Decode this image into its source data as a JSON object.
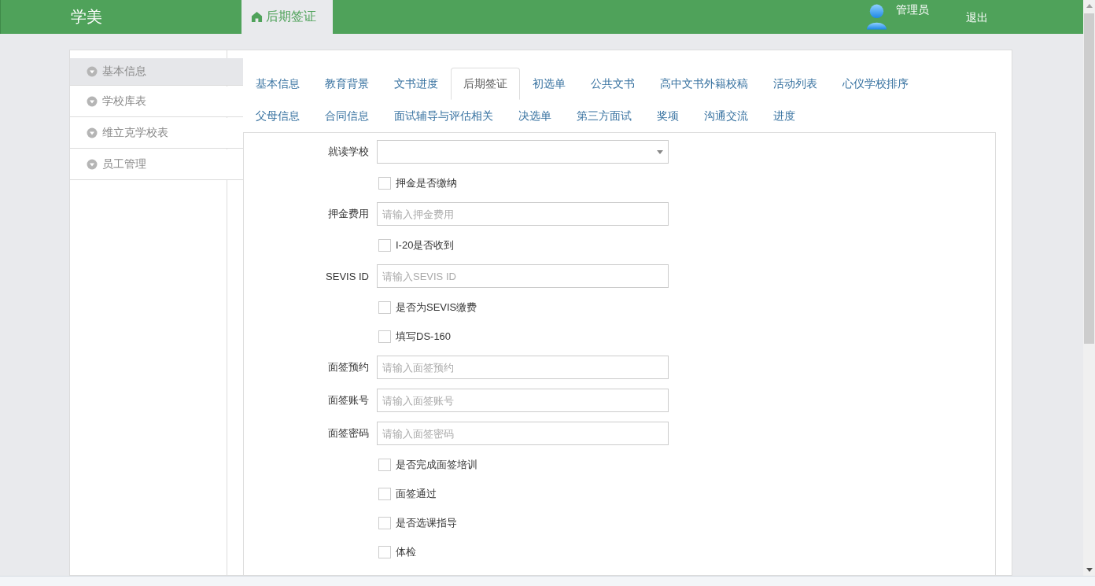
{
  "header": {
    "logo": "学美",
    "nav_tabs": [
      {
        "label": "后期签证",
        "selected": true
      }
    ],
    "user": {
      "name": "管理员"
    },
    "logout": "退出"
  },
  "sidebar": {
    "items": [
      {
        "label": "基本信息",
        "selected": true
      },
      {
        "label": "学校库表",
        "selected": false
      },
      {
        "label": "维立克学校表",
        "selected": false
      },
      {
        "label": "员工管理",
        "selected": false
      }
    ]
  },
  "tab_rows": [
    {
      "tabs": [
        {
          "label": "基本信息",
          "selected": false
        },
        {
          "label": "教育背景",
          "selected": false
        },
        {
          "label": "文书进度",
          "selected": false
        },
        {
          "label": "后期签证",
          "selected": true
        },
        {
          "label": "初选单",
          "selected": false
        },
        {
          "label": "公共文书",
          "selected": false
        },
        {
          "label": "高中文书外籍校稿",
          "selected": false
        },
        {
          "label": "活动列表",
          "selected": false
        },
        {
          "label": "心仪学校排序",
          "selected": false
        }
      ]
    },
    {
      "tabs": [
        {
          "label": "父母信息",
          "selected": false
        },
        {
          "label": "合同信息",
          "selected": false
        },
        {
          "label": "面试辅导与评估相关",
          "selected": false
        },
        {
          "label": "决选单",
          "selected": false
        },
        {
          "label": "第三方面试",
          "selected": false
        },
        {
          "label": "奖项",
          "selected": false
        },
        {
          "label": "沟通交流",
          "selected": false
        },
        {
          "label": "进度",
          "selected": false
        }
      ]
    }
  ],
  "form": {
    "fields": [
      {
        "kind": "select",
        "label": "就读学校"
      },
      {
        "kind": "checkbox",
        "label": "押金是否缴纳",
        "checked": false
      },
      {
        "kind": "input",
        "label": "押金费用",
        "placeholder": "请输入押金费用"
      },
      {
        "kind": "checkbox",
        "label": "I-20是否收到",
        "checked": false
      },
      {
        "kind": "input",
        "label": "SEVIS ID",
        "placeholder": "请输入SEVIS ID"
      },
      {
        "kind": "checkbox",
        "label": "是否为SEVIS缴费",
        "checked": false
      },
      {
        "kind": "checkbox",
        "label": "填写DS-160",
        "checked": false
      },
      {
        "kind": "input",
        "label": "面签预约",
        "placeholder": "请输入面签预约"
      },
      {
        "kind": "input",
        "label": "面签账号",
        "placeholder": "请输入面签账号"
      },
      {
        "kind": "input",
        "label": "面签密码",
        "placeholder": "请输入面签密码"
      },
      {
        "kind": "checkbox",
        "label": "是否完成面签培训",
        "checked": false
      },
      {
        "kind": "checkbox",
        "label": "面签通过",
        "checked": false
      },
      {
        "kind": "checkbox",
        "label": "是否选课指导",
        "checked": false
      },
      {
        "kind": "checkbox",
        "label": "体检",
        "checked": false
      }
    ]
  }
}
